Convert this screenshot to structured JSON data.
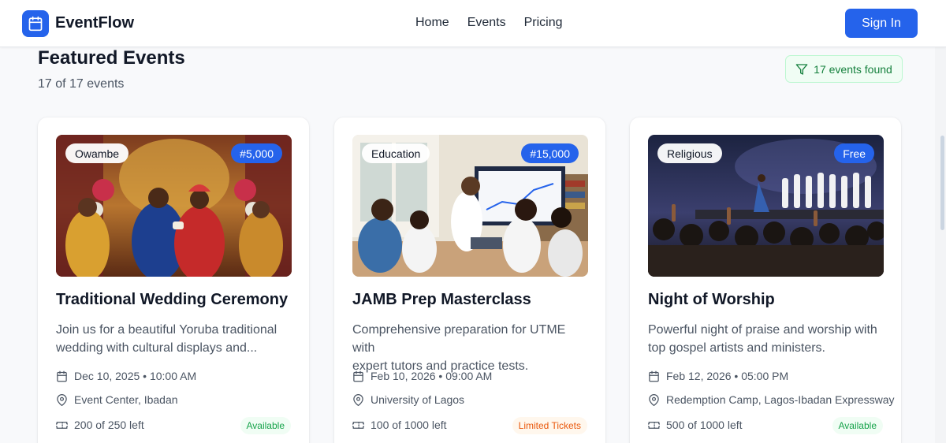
{
  "header": {
    "brand": "EventFlow",
    "nav": [
      "Home",
      "Events",
      "Pricing"
    ],
    "signin_label": "Sign In"
  },
  "page": {
    "title": "Featured Events",
    "subtitle": "17 of 17 events",
    "found_label": "17 events found"
  },
  "events": [
    {
      "category": "Owambe",
      "price": "#5,000",
      "title": "Traditional Wedding Ceremony",
      "desc_line1": "Join us for a beautiful Yoruba traditional",
      "desc_line2": "wedding with cultural displays and...",
      "datetime": "Dec 10, 2025 • 10:00 AM",
      "location": "Event Center, Ibadan",
      "tickets": "200 of 250 left",
      "status": "Available"
    },
    {
      "category": "Education",
      "price": "#15,000",
      "title": "JAMB Prep Masterclass",
      "desc_line1": "Comprehensive preparation for UTME with",
      "desc_line2": "expert tutors and practice tests.",
      "datetime": "Feb 10, 2026 • 09:00 AM",
      "location": "University of Lagos",
      "tickets": "100 of 1000 left",
      "status": "Limited Tickets"
    },
    {
      "category": "Religious",
      "price": "Free",
      "title": "Night of Worship",
      "desc_line1": "Powerful night of praise and worship with",
      "desc_line2": "top gospel artists and ministers.",
      "datetime": "Feb 12, 2026 • 05:00 PM",
      "location": "Redemption Camp, Lagos-Ibadan Expressway",
      "tickets": "500 of 1000 left",
      "status": "Available"
    }
  ],
  "colors": {
    "primary": "#2563eb",
    "available": "#16a34a",
    "limited": "#ea580c"
  }
}
